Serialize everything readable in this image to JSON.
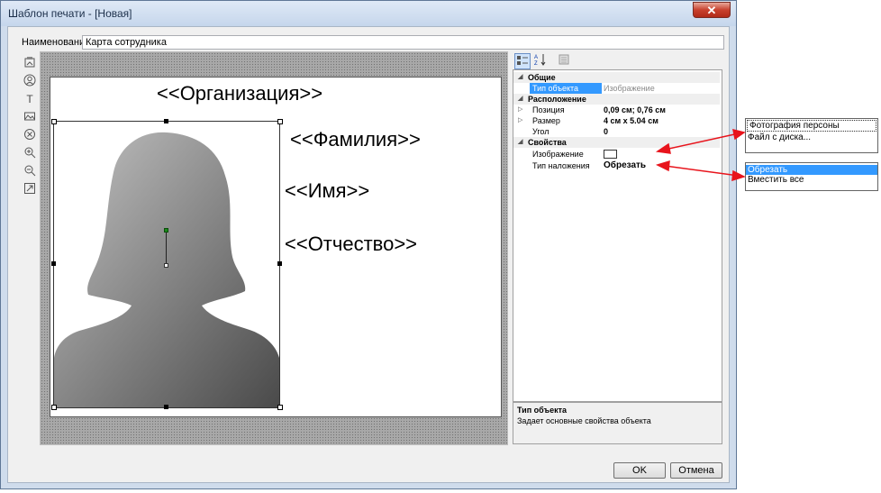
{
  "window": {
    "title": "Шаблон печати - [Новая]",
    "close_glyph": "✕"
  },
  "form": {
    "name_label": "Наименование",
    "name_value": "Карта сотрудника"
  },
  "toolbox": {
    "items": [
      "image-insert-icon",
      "person-icon",
      "text-tool-icon",
      "picture-tool-icon",
      "delete-icon",
      "zoom-in-icon",
      "zoom-out-icon",
      "fit-icon"
    ],
    "text_glyph": "T"
  },
  "card": {
    "org": "<<Организация>>",
    "surname": "<<Фамилия>>",
    "name": "<<Имя>>",
    "patronymic": "<<Отчество>>"
  },
  "props": {
    "cat_general": "Общие",
    "type_label": "Тип объекта",
    "type_value": "Изображение",
    "cat_layout": "Расположение",
    "position_label": "Позиция",
    "position_value": "0,09 см; 0,76 см",
    "size_label": "Размер",
    "size_value": "4 см x 5.04 см",
    "angle_label": "Угол",
    "angle_value": "0",
    "cat_props": "Свойства",
    "image_label": "Изображение",
    "overlay_label": "Тип наложения",
    "overlay_value": "Обрезать"
  },
  "description": {
    "title": "Тип объекта",
    "text": "Задает основные свойства объекта"
  },
  "buttons": {
    "ok": "OK",
    "cancel": "Отмена"
  },
  "popup_image": {
    "items": [
      "Фотография персоны",
      "Файл с диска..."
    ]
  },
  "popup_overlay": {
    "items": [
      "Обрезать",
      "Вместить все"
    ],
    "selected": "Обрезать"
  },
  "colors": {
    "selection": "#3399ff",
    "arrow": "#e8141c",
    "anchor": "#1a8a1a"
  }
}
